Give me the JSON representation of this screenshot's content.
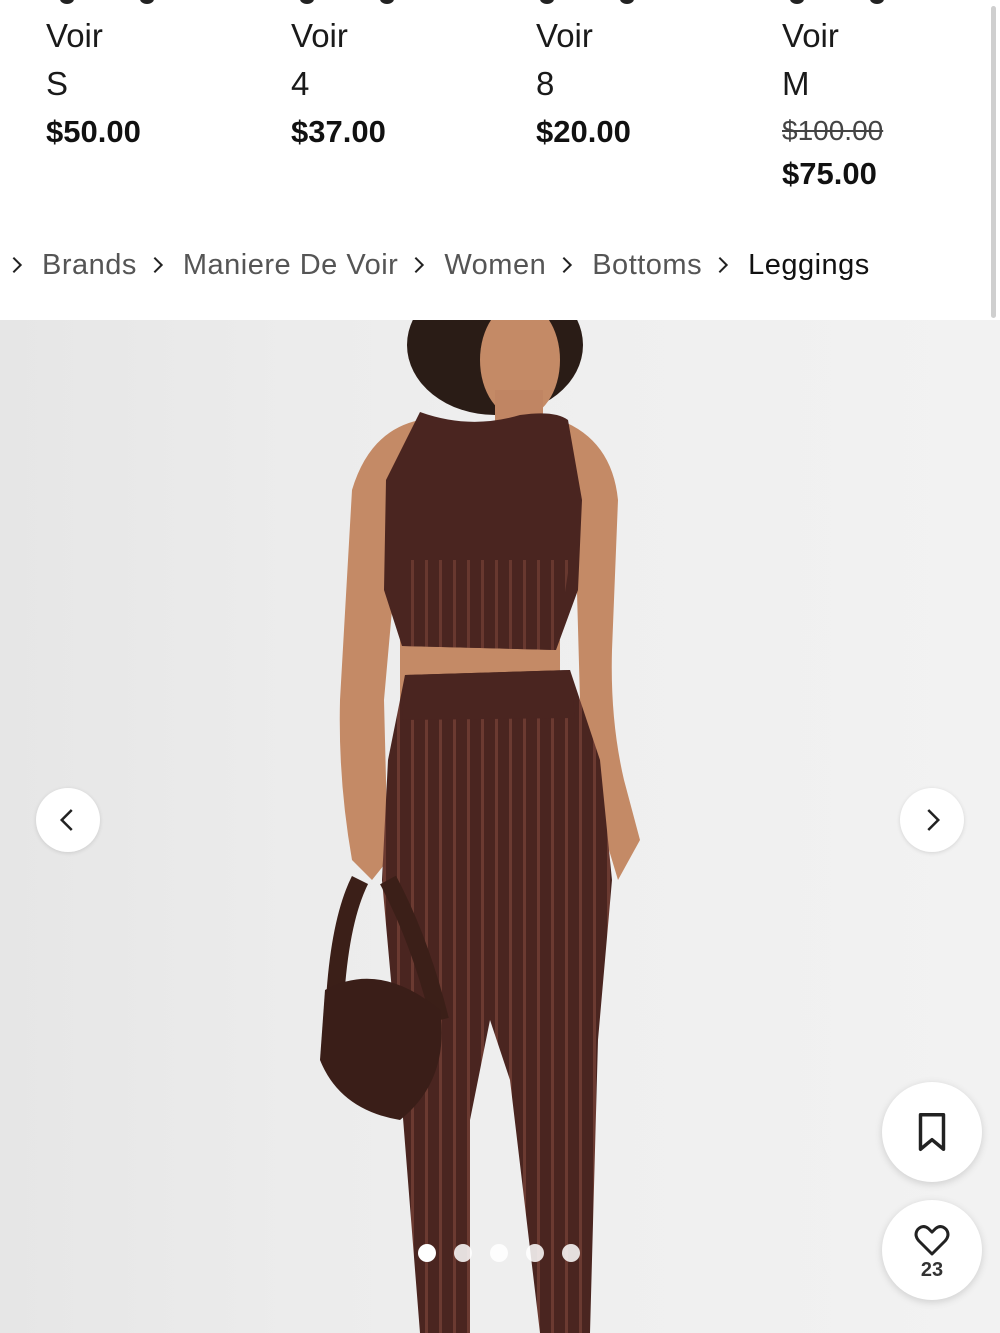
{
  "related_products": [
    {
      "brand": "Voir",
      "size": "S",
      "price": "$50.00",
      "old_price": ""
    },
    {
      "brand": "Voir",
      "size": "4",
      "price": "$37.00",
      "old_price": ""
    },
    {
      "brand": "Voir",
      "size": "8",
      "price": "$20.00",
      "old_price": ""
    },
    {
      "brand": "Voir",
      "size": "M",
      "price": "$75.00",
      "old_price": "$100.00"
    }
  ],
  "breadcrumb": [
    {
      "label": "Brands"
    },
    {
      "label": "Maniere De Voir"
    },
    {
      "label": "Women"
    },
    {
      "label": "Bottoms"
    },
    {
      "label": "Leggings"
    }
  ],
  "gallery": {
    "image_count": 5,
    "active_index": 0
  },
  "actions": {
    "like_count": "23"
  },
  "colors": {
    "garment": "#4a2520",
    "background": "#ececec"
  }
}
